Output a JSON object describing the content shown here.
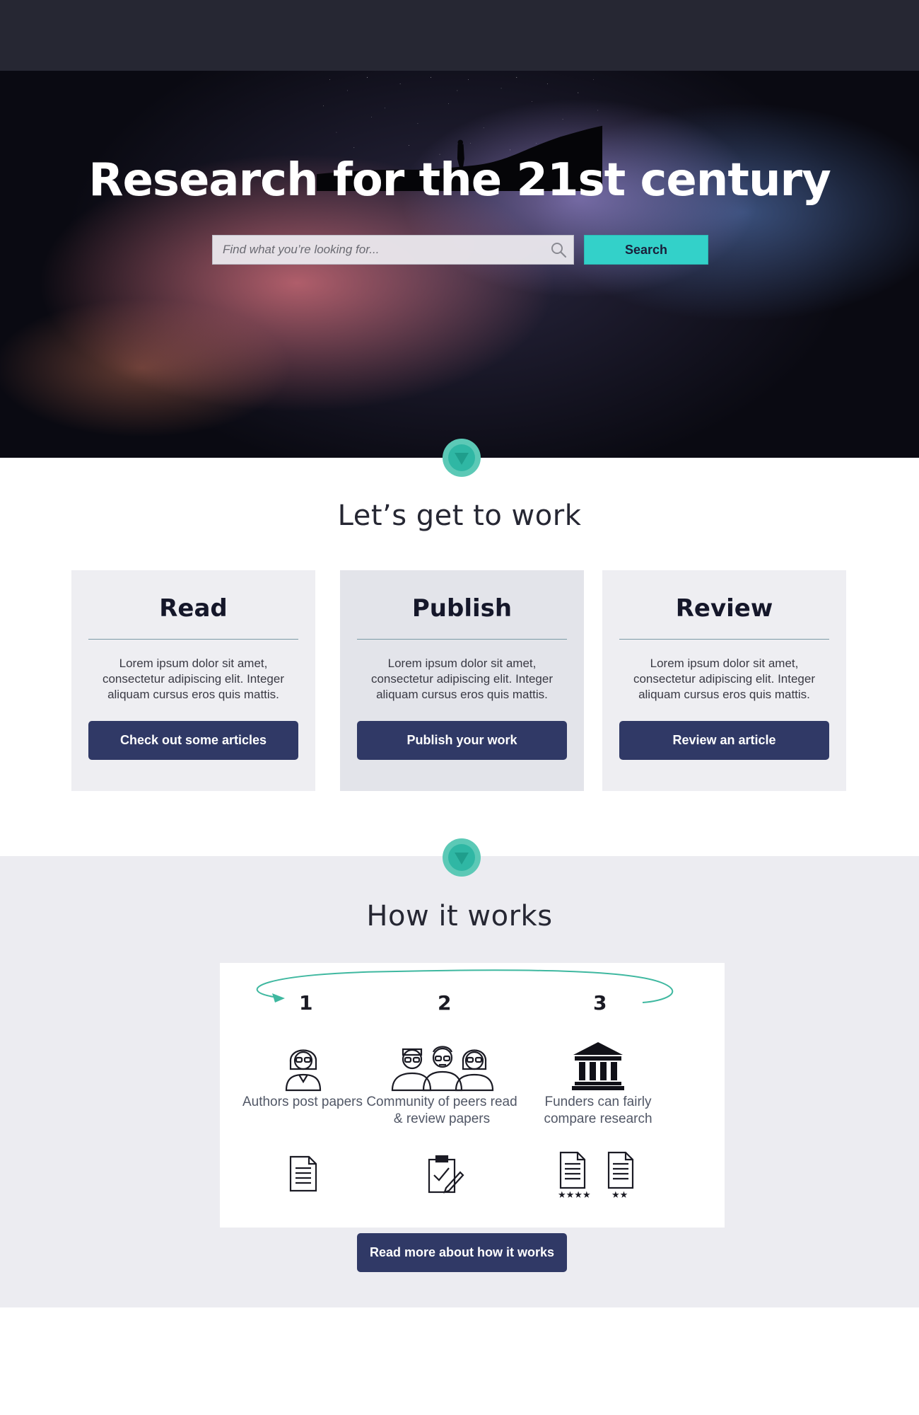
{
  "hero": {
    "title": "Research for the 21st century",
    "search_placeholder": "Find what you’re looking for...",
    "search_icon": "search-icon",
    "search_button": "Search"
  },
  "work": {
    "title": "Let’s get to work",
    "cards": [
      {
        "title": "Read",
        "text": "Lorem ipsum dolor sit amet, consectetur adipiscing elit. Integer aliquam cursus eros quis mattis.",
        "button": "Check out some articles"
      },
      {
        "title": "Publish",
        "text": "Lorem ipsum dolor sit amet, consectetur adipiscing elit. Integer aliquam cursus eros quis mattis.",
        "button": "Publish your work"
      },
      {
        "title": "Review",
        "text": "Lorem ipsum dolor sit amet, consectetur adipiscing elit. Integer aliquam cursus eros quis mattis.",
        "button": "Review an article"
      }
    ]
  },
  "how": {
    "title": "How it works",
    "steps": [
      {
        "number": "1",
        "label": "Authors post papers",
        "icon": "author-icon",
        "doc_icon": "document-icon"
      },
      {
        "number": "2",
        "label": "Community of peers read & review papers",
        "icon": "peers-icon",
        "doc_icon": "clipboard-review-icon"
      },
      {
        "number": "3",
        "label": "Funders can fairly compare research",
        "icon": "institution-icon",
        "doc_icon": "rated-documents-icon"
      }
    ],
    "button": "Read more about how it works"
  },
  "colors": {
    "nav_dark": "#262733",
    "accent_teal": "#33d1c9",
    "chevron_teal": "#2fb7a4",
    "button_navy": "#303966",
    "arc_green": "#3fb8a0"
  }
}
